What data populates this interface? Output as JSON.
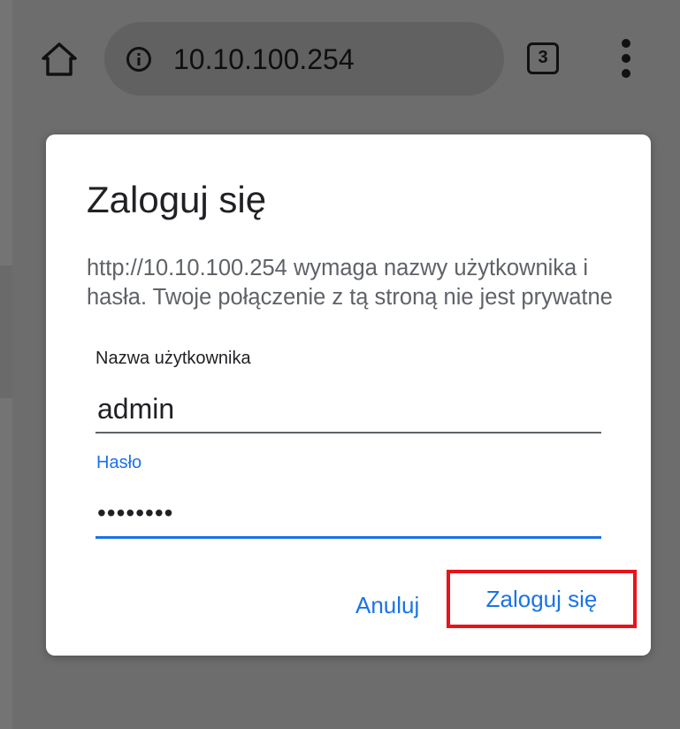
{
  "toolbar": {
    "url": "10.10.100.254",
    "tab_count": "3"
  },
  "dialog": {
    "title": "Zaloguj się",
    "message": "http://10.10.100.254 wymaga nazwy użytkownika i hasła. Twoje połączenie z tą stroną nie jest prywatne",
    "username_label": "Nazwa użytkownika",
    "username_value": "admin",
    "password_label": "Hasło",
    "password_value": "password",
    "cancel_label": "Anuluj",
    "login_label": "Zaloguj się"
  },
  "colors": {
    "accent": "#1a73e8",
    "highlight": "#e8131b",
    "scrim": "#6d6d6d"
  },
  "icons": {
    "home": "home-icon",
    "info": "info-icon",
    "tabs": "tab-switcher-icon",
    "menu": "more-vertical-icon"
  }
}
